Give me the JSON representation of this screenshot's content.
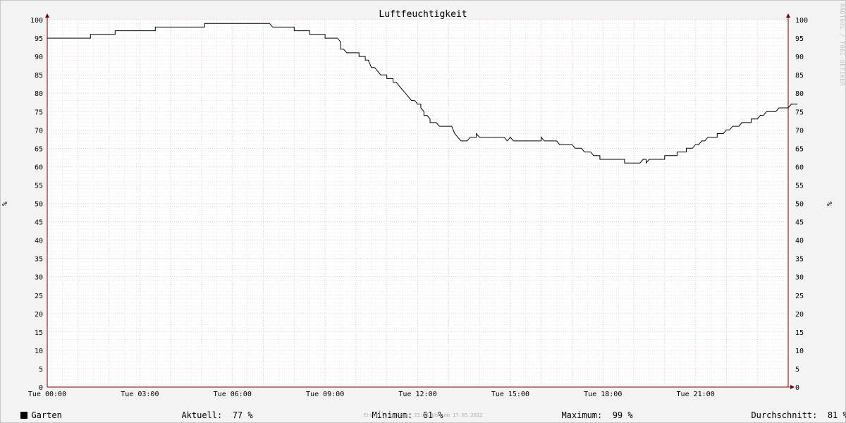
{
  "chart_data": {
    "type": "line",
    "title": "Luftfeuchtigkeit",
    "ylabel": "%",
    "ylim": [
      0,
      100
    ],
    "y_ticks": [
      0,
      5,
      10,
      15,
      20,
      25,
      30,
      35,
      40,
      45,
      50,
      55,
      60,
      65,
      70,
      75,
      80,
      85,
      90,
      95,
      100
    ],
    "x_tick_labels": [
      "Tue 00:00",
      "Tue 03:00",
      "Tue 06:00",
      "Tue 09:00",
      "Tue 12:00",
      "Tue 15:00",
      "Tue 18:00",
      "Tue 21:00"
    ],
    "x_unit": "hours",
    "xlim": [
      0,
      24
    ],
    "grid": true,
    "series": [
      {
        "name": "Garten",
        "color": "#000000",
        "points": [
          [
            0.0,
            95
          ],
          [
            1.4,
            95
          ],
          [
            1.4,
            96
          ],
          [
            2.2,
            96
          ],
          [
            2.2,
            97
          ],
          [
            3.5,
            97
          ],
          [
            3.5,
            98
          ],
          [
            5.1,
            98
          ],
          [
            5.1,
            99
          ],
          [
            7.2,
            99
          ],
          [
            7.3,
            98
          ],
          [
            8.0,
            98
          ],
          [
            8.0,
            97
          ],
          [
            8.5,
            97
          ],
          [
            8.5,
            96
          ],
          [
            9.0,
            96
          ],
          [
            9.0,
            95
          ],
          [
            9.4,
            95
          ],
          [
            9.5,
            94
          ],
          [
            9.5,
            92
          ],
          [
            9.6,
            92
          ],
          [
            9.7,
            91
          ],
          [
            10.1,
            91
          ],
          [
            10.1,
            90
          ],
          [
            10.3,
            90
          ],
          [
            10.3,
            89
          ],
          [
            10.4,
            89
          ],
          [
            10.5,
            87
          ],
          [
            10.6,
            87
          ],
          [
            10.7,
            86
          ],
          [
            10.8,
            85
          ],
          [
            11.0,
            85
          ],
          [
            11.0,
            84
          ],
          [
            11.2,
            84
          ],
          [
            11.2,
            83
          ],
          [
            11.3,
            83
          ],
          [
            11.4,
            82
          ],
          [
            11.5,
            81
          ],
          [
            11.6,
            80
          ],
          [
            11.7,
            79
          ],
          [
            11.8,
            78
          ],
          [
            11.9,
            78
          ],
          [
            12.0,
            77
          ],
          [
            12.1,
            77
          ],
          [
            12.1,
            76
          ],
          [
            12.2,
            75
          ],
          [
            12.2,
            74
          ],
          [
            12.3,
            74
          ],
          [
            12.4,
            73
          ],
          [
            12.4,
            72
          ],
          [
            12.6,
            72
          ],
          [
            12.7,
            71
          ],
          [
            13.1,
            71
          ],
          [
            13.2,
            69
          ],
          [
            13.3,
            68
          ],
          [
            13.4,
            67
          ],
          [
            13.6,
            67
          ],
          [
            13.7,
            68
          ],
          [
            13.9,
            68
          ],
          [
            13.9,
            69
          ],
          [
            14.0,
            68
          ],
          [
            14.8,
            68
          ],
          [
            14.9,
            67
          ],
          [
            15.0,
            68
          ],
          [
            15.1,
            67
          ],
          [
            16.0,
            67
          ],
          [
            16.0,
            68
          ],
          [
            16.1,
            67
          ],
          [
            16.5,
            67
          ],
          [
            16.6,
            66
          ],
          [
            17.0,
            66
          ],
          [
            17.1,
            65
          ],
          [
            17.3,
            65
          ],
          [
            17.4,
            64
          ],
          [
            17.6,
            64
          ],
          [
            17.7,
            63
          ],
          [
            17.9,
            63
          ],
          [
            17.9,
            62
          ],
          [
            18.7,
            62
          ],
          [
            18.7,
            61
          ],
          [
            19.2,
            61
          ],
          [
            19.3,
            62
          ],
          [
            19.4,
            62
          ],
          [
            19.4,
            61
          ],
          [
            19.5,
            62
          ],
          [
            20.0,
            62
          ],
          [
            20.0,
            63
          ],
          [
            20.4,
            63
          ],
          [
            20.4,
            64
          ],
          [
            20.7,
            64
          ],
          [
            20.7,
            65
          ],
          [
            20.9,
            65
          ],
          [
            21.0,
            66
          ],
          [
            21.1,
            66
          ],
          [
            21.2,
            67
          ],
          [
            21.3,
            67
          ],
          [
            21.4,
            68
          ],
          [
            21.7,
            68
          ],
          [
            21.7,
            69
          ],
          [
            21.9,
            69
          ],
          [
            22.0,
            70
          ],
          [
            22.1,
            70
          ],
          [
            22.2,
            71
          ],
          [
            22.4,
            71
          ],
          [
            22.5,
            72
          ],
          [
            22.8,
            72
          ],
          [
            22.8,
            73
          ],
          [
            23.0,
            73
          ],
          [
            23.1,
            74
          ],
          [
            23.2,
            74
          ],
          [
            23.3,
            75
          ],
          [
            23.6,
            75
          ],
          [
            23.7,
            76
          ],
          [
            24.0,
            76
          ],
          [
            24.1,
            77
          ],
          [
            24.3,
            77
          ]
        ]
      }
    ]
  },
  "legend": {
    "series_name": "Garten",
    "series_color": "#000000",
    "current_label": "Aktuell:",
    "current_value": "77 %",
    "min_label": "Minimum:",
    "min_value": "61 %",
    "max_label": "Maximum:",
    "max_value": "99 %",
    "avg_label": "Durchschnitt:",
    "avg_value": "81 %"
  },
  "footer": "Erstellungszeit: 23:55 Uhr am 17.05.2022",
  "watermark": "RRDTOOL / TOBI OETIKER",
  "colors": {
    "background": "#f3f3f3",
    "plot_background": "#ffffff",
    "major_grid": "#e5a0a0",
    "minor_grid": "#cfcfcf",
    "axis": "#7a0000"
  }
}
